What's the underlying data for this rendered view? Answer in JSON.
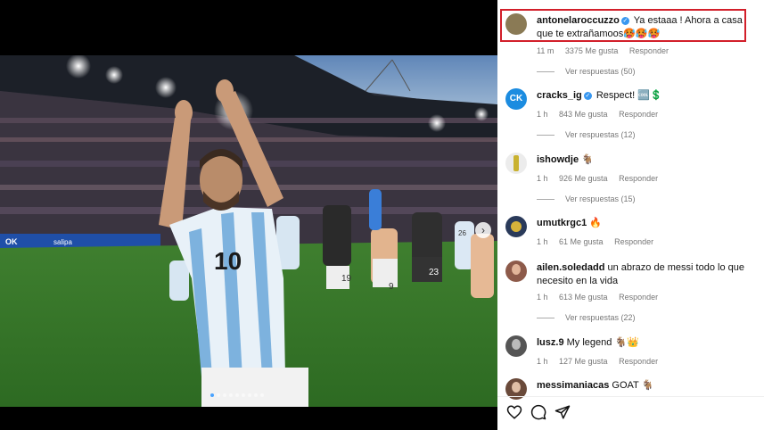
{
  "post": {
    "photo": {
      "jersey_number": "10",
      "player_numbers": [
        "19",
        "9",
        "23",
        "26"
      ],
      "ad_board_text": "OK",
      "ad_board_brand": "salipa",
      "carousel_dots": 9,
      "active_dot": 0
    },
    "next_icon": "›"
  },
  "comments": [
    {
      "username": "antonelaroccuzzo",
      "verified": true,
      "text": "Ya estaaa ! Ahora a casa que te extrañamoos🥵🥵🥵",
      "time": "11 m",
      "likes": "3375 Me gusta",
      "reply": "Responder",
      "replies_label": "Ver respuestas (50)",
      "avatar_color": "#8a7a55"
    },
    {
      "username": "cracks_ig",
      "verified": true,
      "text": "Respect! 🆒💲",
      "time": "1 h",
      "likes": "843 Me gusta",
      "reply": "Responder",
      "replies_label": "Ver respuestas (12)",
      "avatar_color": "#1c8ce0",
      "avatar_text": "CK"
    },
    {
      "username": "ishowdje",
      "verified": false,
      "text": "🐐",
      "time": "1 h",
      "likes": "926 Me gusta",
      "reply": "Responder",
      "replies_label": "Ver respuestas (15)",
      "avatar_color": "#d8d8d8"
    },
    {
      "username": "umutkrgc1",
      "verified": false,
      "text": "🔥",
      "time": "1 h",
      "likes": "61 Me gusta",
      "reply": "Responder",
      "avatar_color": "#2a3a5a"
    },
    {
      "username": "ailen.soledadd",
      "verified": false,
      "text": "un abrazo de messi todo lo que necesito en la vida",
      "time": "1 h",
      "likes": "613 Me gusta",
      "reply": "Responder",
      "replies_label": "Ver respuestas (22)",
      "avatar_color": "#8d5a4a"
    },
    {
      "username": "lusz.9",
      "verified": false,
      "text": "My legend 🐐👑",
      "time": "1 h",
      "likes": "127 Me gusta",
      "reply": "Responder",
      "avatar_color": "#555555"
    },
    {
      "username": "messimaniacas",
      "verified": false,
      "text": "GOAT 🐐",
      "avatar_color": "#6a4a3a"
    }
  ],
  "actions": [
    {
      "icon": "heart-icon"
    },
    {
      "icon": "comment-icon"
    },
    {
      "icon": "share-icon"
    }
  ]
}
